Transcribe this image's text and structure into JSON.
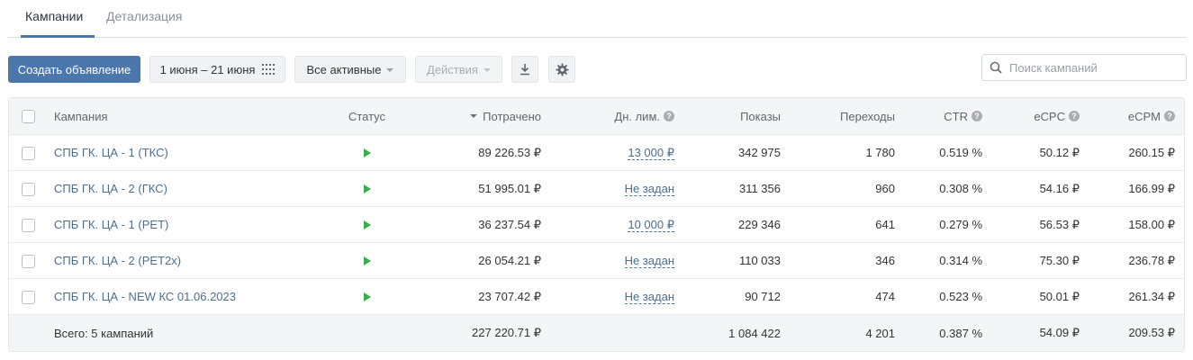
{
  "tabs": [
    {
      "label": "Кампании"
    },
    {
      "label": "Детализация"
    }
  ],
  "toolbar": {
    "create_label": "Создать объявление",
    "date_range": "1 июня – 21 июня",
    "filter_value": "Все активные",
    "actions_label": "Действия"
  },
  "search": {
    "placeholder": "Поиск кампаний",
    "value": ""
  },
  "table": {
    "headers": {
      "campaign": "Кампания",
      "status": "Статус",
      "spent": "Потрачено",
      "limit": "Дн. лим.",
      "shows": "Показы",
      "clicks": "Переходы",
      "ctr": "CTR",
      "ecpc": "eCPC",
      "ecpm": "eCPM"
    },
    "rows": [
      {
        "name": "СПБ ГК. ЦА - 1 (ТКС)",
        "status": "active",
        "spent": "89 226.53 ₽",
        "limit": "13 000 ₽",
        "shows": "342 975",
        "clicks": "1 780",
        "ctr": "0.519 %",
        "ecpc": "50.12 ₽",
        "ecpm": "260.15 ₽"
      },
      {
        "name": "СПБ ГК. ЦА - 2 (ГКС)",
        "status": "active",
        "spent": "51 995.01 ₽",
        "limit": "Не задан",
        "shows": "311 356",
        "clicks": "960",
        "ctr": "0.308 %",
        "ecpc": "54.16 ₽",
        "ecpm": "166.99 ₽"
      },
      {
        "name": "СПБ ГК. ЦА - 1 (РЕТ)",
        "status": "active",
        "spent": "36 237.54 ₽",
        "limit": "10 000 ₽",
        "shows": "229 346",
        "clicks": "641",
        "ctr": "0.279 %",
        "ecpc": "56.53 ₽",
        "ecpm": "158.00 ₽"
      },
      {
        "name": "СПБ ГК. ЦА - 2 (РЕТ2х)",
        "status": "active",
        "spent": "26 054.21 ₽",
        "limit": "Не задан",
        "shows": "110 033",
        "clicks": "346",
        "ctr": "0.314 %",
        "ecpc": "75.30 ₽",
        "ecpm": "236.78 ₽"
      },
      {
        "name": "СПБ ГК. ЦА - NEW КС 01.06.2023",
        "status": "active",
        "spent": "23 707.42 ₽",
        "limit": "Не задан",
        "shows": "90 712",
        "clicks": "474",
        "ctr": "0.523 %",
        "ecpc": "50.01 ₽",
        "ecpm": "261.34 ₽"
      }
    ],
    "total": {
      "label": "Всего: 5 кампаний",
      "spent": "227 220.71 ₽",
      "shows": "1 084 422",
      "clicks": "4 201",
      "ctr": "0.387 %",
      "ecpc": "54.09 ₽",
      "ecpm": "209.53 ₽"
    }
  },
  "colors": {
    "accent": "#4b77ad",
    "link": "#4b6f94",
    "status_active": "#3daa4a"
  }
}
